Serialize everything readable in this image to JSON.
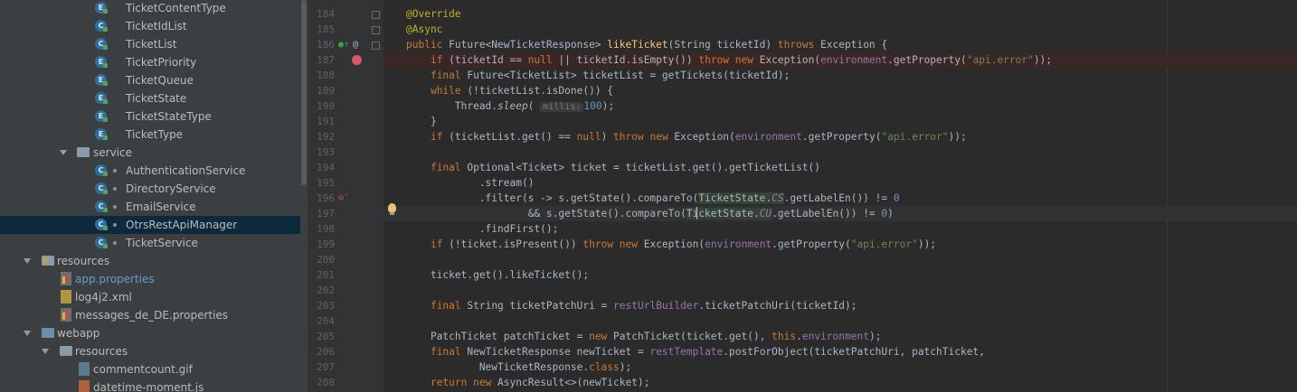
{
  "project_tree": {
    "items": [
      {
        "label": "TicketContentType",
        "icon": "enum-icon"
      },
      {
        "label": "TicketIdList",
        "icon": "class-icon"
      },
      {
        "label": "TicketList",
        "icon": "class-icon"
      },
      {
        "label": "TicketPriority",
        "icon": "enum-icon"
      },
      {
        "label": "TicketQueue",
        "icon": "enum-icon"
      },
      {
        "label": "TicketState",
        "icon": "enum-icon"
      },
      {
        "label": "TicketStateType",
        "icon": "enum-icon"
      },
      {
        "label": "TicketType",
        "icon": "enum-icon"
      },
      {
        "label": "service",
        "icon": "package-icon"
      },
      {
        "label": "AuthenticationService",
        "icon": "class-icon"
      },
      {
        "label": "DirectoryService",
        "icon": "class-icon"
      },
      {
        "label": "EmailService",
        "icon": "class-icon"
      },
      {
        "label": "OtrsRestApiManager",
        "icon": "class-icon"
      },
      {
        "label": "TicketService",
        "icon": "class-icon"
      },
      {
        "label": "resources",
        "icon": "resources-folder-icon"
      },
      {
        "label": "app.properties",
        "icon": "properties-file-icon"
      },
      {
        "label": "log4j2.xml",
        "icon": "xml-file-icon"
      },
      {
        "label": "messages_de_DE.properties",
        "icon": "properties-file-icon"
      },
      {
        "label": "webapp",
        "icon": "web-folder-icon"
      },
      {
        "label": "resources",
        "icon": "folder-icon"
      },
      {
        "label": "commentcount.gif",
        "icon": "image-file-icon"
      },
      {
        "label": "datetime-moment.js",
        "icon": "js-file-icon"
      }
    ],
    "selected": "OtrsRestApiManager"
  },
  "editor": {
    "line_numbers": [
      "184",
      "185",
      "186",
      "187",
      "188",
      "189",
      "190",
      "191",
      "192",
      "193",
      "194",
      "195",
      "196",
      "197",
      "198",
      "199",
      "200",
      "201",
      "202",
      "203",
      "204",
      "205",
      "206",
      "207",
      "208"
    ],
    "hint_millis": "millis:",
    "colors": {
      "background": "#2b2b2b",
      "keyword": "#cc7832",
      "string": "#6a8759",
      "annotation": "#bbb529",
      "method": "#ffc66d",
      "field": "#9876aa",
      "number": "#6897bb",
      "breakpoint": "#db5860"
    }
  }
}
